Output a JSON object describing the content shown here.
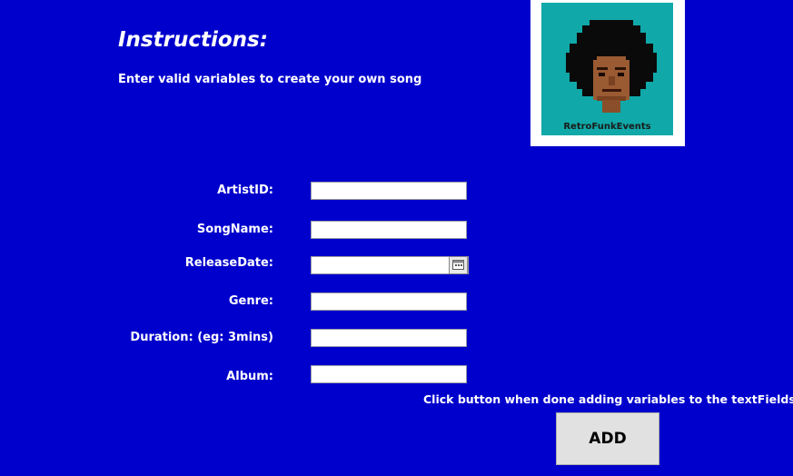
{
  "instructions": {
    "title": "Instructions:",
    "subtitle": "Enter valid variables to create your own song"
  },
  "logo": {
    "text": "RetroFunkEvents",
    "icon": "pixel-art-afro-portrait"
  },
  "form": {
    "artist_id_label": "ArtistID:",
    "artist_id_value": "",
    "song_name_label": "SongName:",
    "song_name_value": "",
    "release_date_label": "ReleaseDate:",
    "release_date_value": "",
    "calendar_icon": "calendar-icon",
    "genre_label": "Genre:",
    "genre_value": "",
    "duration_label": "Duration: (eg: 3mins)",
    "duration_value": "",
    "album_label": "Album:",
    "album_value": ""
  },
  "hint": "Click button when done adding variables to the textFields",
  "add_button_label": "ADD",
  "colors": {
    "background": "#0000cc",
    "text": "#ffffff",
    "logo_background": "#10a8a8",
    "button_face": "#e1e1e1"
  }
}
